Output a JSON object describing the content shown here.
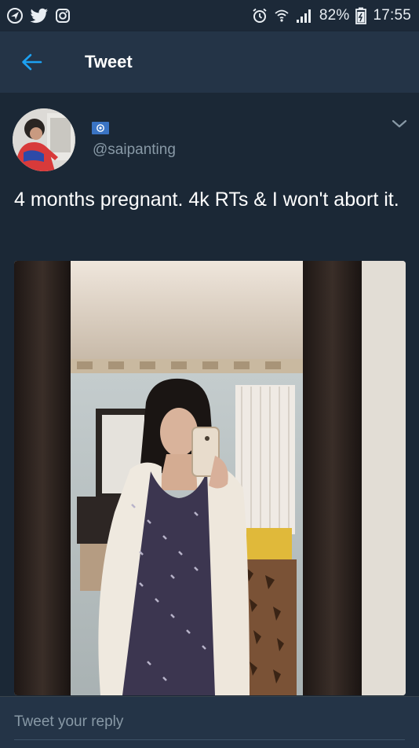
{
  "status_bar": {
    "battery": "82%",
    "time": "17:55",
    "left_icons": [
      "navigation-icon",
      "twitter-icon",
      "instagram-icon"
    ],
    "right_icons": [
      "alarm-icon",
      "wifi-icon",
      "signal-icon",
      "battery-icon"
    ]
  },
  "header": {
    "title": "Tweet",
    "back_icon": "arrow-left-icon"
  },
  "tweet": {
    "handle": "@saipanting",
    "text": "4 months pregnant. 4k RTs & I won't abort it.",
    "menu_icon": "chevron-down-icon"
  },
  "reply": {
    "placeholder": "Tweet your reply"
  },
  "colors": {
    "background": "#1b2836",
    "header": "#243447",
    "accent": "#1da1f2",
    "secondary_text": "#8899a6"
  }
}
